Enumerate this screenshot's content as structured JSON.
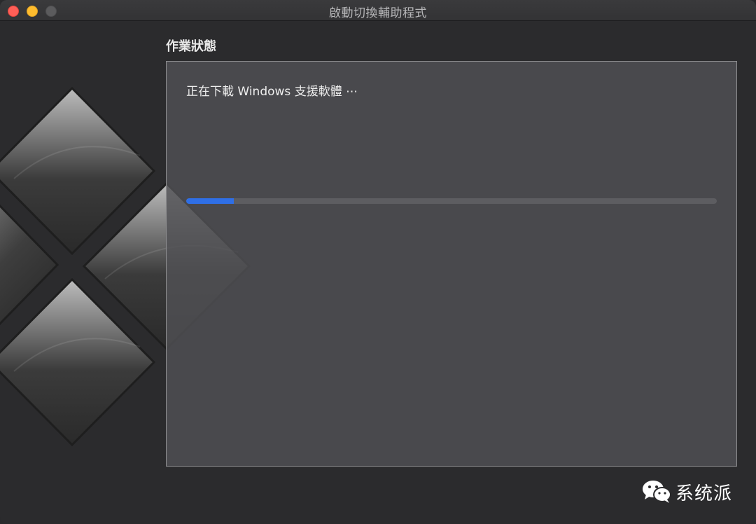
{
  "window": {
    "title": "啟動切換輔助程式"
  },
  "main": {
    "section_title": "作業狀態",
    "status_text": "正在下載 Windows 支援軟體 ⋯",
    "progress": 0.09,
    "progress_color": "#2f6fe6"
  },
  "watermark": {
    "text": "系统派",
    "icon": "wechat-icon"
  },
  "colors": {
    "close": "#fe5f57",
    "minimize": "#febc2e",
    "zoom_inactive": "#5b5b5d"
  }
}
